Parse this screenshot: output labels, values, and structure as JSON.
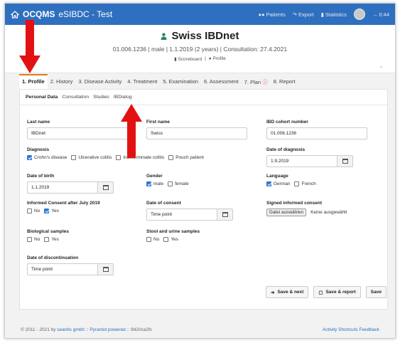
{
  "app": {
    "brand_bold": "OCQMS",
    "brand_rest": "eSIBDC - Test",
    "nav": [
      "Patients",
      "Export",
      "Statistics",
      "0:44"
    ]
  },
  "patient": {
    "name": "Swiss IBDnet",
    "info": "01.006.1236 | male | 1.1.2019 (2 years) | Consultation: 27.4.2021",
    "links": [
      "Scoreboard",
      "Profile"
    ],
    "separator": "|"
  },
  "tabs": [
    "1. Profile",
    "2. History",
    "3. Disease Activity",
    "4. Treatment",
    "5. Examination",
    "6. Assessment",
    "7. Plan",
    "8. Report"
  ],
  "subtabs": [
    "Personal Data",
    "Consultation",
    "Studies",
    "IBDialog"
  ],
  "form": {
    "last_name": {
      "label": "Last name",
      "value": "IBDnet"
    },
    "first_name": {
      "label": "First name",
      "value": "Swiss"
    },
    "cohort": {
      "label": "IBD cohort number",
      "value": "01.006.1236"
    },
    "diagnosis": {
      "label": "Diagnosis",
      "options": [
        "Crohn's disease",
        "Ulcerative colitis",
        "Indeterminate colitis",
        "Pouch patient"
      ]
    },
    "date_diag": {
      "label": "Date of diagnosis",
      "value": "1.9.2019"
    },
    "dob": {
      "label": "Date of birth",
      "value": "1.1.2019"
    },
    "gender": {
      "label": "Gender",
      "options": [
        "male",
        "female"
      ]
    },
    "language": {
      "label": "Language",
      "options": [
        "German",
        "French"
      ]
    },
    "consent": {
      "label": "Informed Consent after July 2019",
      "options": [
        "No",
        "Yes"
      ]
    },
    "date_consent": {
      "label": "Date of consent",
      "placeholder": "Time point"
    },
    "signed": {
      "label": "Signed informed consent",
      "button": "Datei auswählen",
      "status": "Keine ausgewählt"
    },
    "bio": {
      "label": "Biological samples",
      "options": [
        "No",
        "Yes"
      ]
    },
    "stool": {
      "label": "Stool and urine samples",
      "options": [
        "No",
        "Yes"
      ]
    },
    "discont": {
      "label": "Date of discontinuation",
      "placeholder": "Time point"
    }
  },
  "buttons": {
    "save_next": "Save & next",
    "save_report": "Save & report",
    "save": "Save"
  },
  "footer": {
    "copy": "© 2011 - 2021 by",
    "seantis": "seantis gmbh",
    "sep1": "::",
    "pyramid": "Pyramid powered",
    "sep2": "::",
    "hash": "9d20ca2fc",
    "right": "Activity Shortcuts Feedback"
  },
  "colors": {
    "topbar": "#2f6fbf",
    "accent_tab": "#e07a16",
    "arrow": "#e31212",
    "checkbox": "#2f79d4"
  }
}
